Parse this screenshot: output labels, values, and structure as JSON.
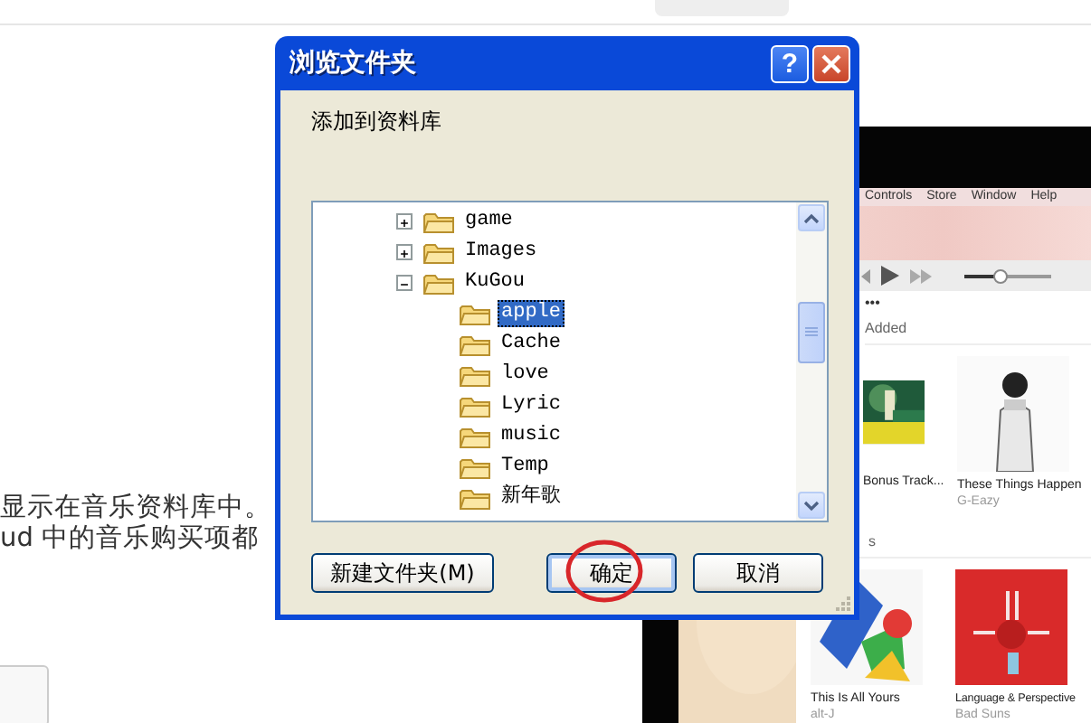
{
  "page": {
    "paragraph_lines": [
      "显示在音乐资料库中。",
      "ud 中的音乐购买项都"
    ]
  },
  "screenshot": {
    "menu": [
      "Controls",
      "Store",
      "Window",
      "Help"
    ],
    "volume": {
      "level": 0.42
    },
    "more": "•••",
    "shelves": [
      {
        "heading": "Added",
        "albums": [
          {
            "title": "Bonus Track..."
          },
          {
            "title": "These Things Happen",
            "artist": "G-Eazy"
          }
        ]
      },
      {
        "heading": "s",
        "albums": [
          {
            "title": "This Is All Yours",
            "artist": "alt-J"
          },
          {
            "title": "Language & Perspective",
            "artist": "Bad Suns"
          }
        ]
      }
    ]
  },
  "dialog": {
    "title": "浏览文件夹",
    "help": "?",
    "prompt": "添加到资料库",
    "tree": [
      {
        "label": "game",
        "expanded": false,
        "selected": false
      },
      {
        "label": "Images",
        "expanded": false,
        "selected": false
      },
      {
        "label": "KuGou",
        "expanded": true,
        "selected": false,
        "children": [
          {
            "label": "apple",
            "selected": true
          },
          {
            "label": "Cache",
            "selected": false
          },
          {
            "label": "love",
            "selected": false
          },
          {
            "label": "Lyric",
            "selected": false
          },
          {
            "label": "music",
            "selected": false
          },
          {
            "label": "Temp",
            "selected": false
          },
          {
            "label": "新年歌",
            "selected": false
          }
        ]
      }
    ],
    "buttons": [
      {
        "label": "新建文件夹(M)",
        "default": false,
        "circled": false
      },
      {
        "label": "确定",
        "default": true,
        "circled": true
      },
      {
        "label": "取消",
        "default": false,
        "circled": false
      }
    ]
  }
}
